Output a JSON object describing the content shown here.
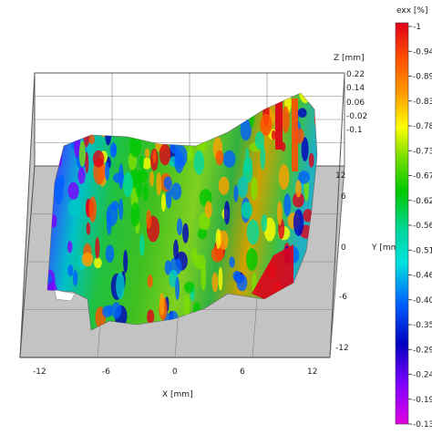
{
  "chart_data": {
    "type": "heatmap",
    "title": "",
    "surface": "3D strain map (exx) on measured surface",
    "xlabel": "X [mm]",
    "ylabel": "Y [mm]",
    "zlabel": "Z [mm]",
    "x_ticks": [
      "-12",
      "-6",
      "0",
      "6",
      "12"
    ],
    "y_ticks": [
      "12",
      "6",
      "0",
      "-6",
      "-12"
    ],
    "z_ticks": [
      "0.22",
      "0.14",
      "0.06",
      "-0.02",
      "-0.1"
    ],
    "xlim": [
      -12,
      12
    ],
    "ylim": [
      -12,
      12
    ],
    "zlim": [
      -0.1,
      0.22
    ],
    "grid": true,
    "colorbar": {
      "label": "exx [%]",
      "ticks": [
        "-1",
        "-0.946",
        "-0.892",
        "-0.838",
        "-0.784",
        "-0.73",
        "-0.676",
        "-0.622",
        "-0.568",
        "-0.514",
        "-0.46",
        "-0.406",
        "-0.352",
        "-0.298",
        "-0.244",
        "-0.19",
        "-0.136"
      ],
      "range": [
        -1,
        -0.136
      ],
      "colors": [
        "#e0001a",
        "#ff5000",
        "#ffa000",
        "#ffff00",
        "#80e000",
        "#00c800",
        "#00d8a0",
        "#00e0e0",
        "#0060ff",
        "#0000c0",
        "#8000ff",
        "#e000e0"
      ]
    }
  },
  "colors": {
    "box_wall": "#c3c3c3",
    "grid_line": "#808080",
    "background": "#ffffff"
  }
}
